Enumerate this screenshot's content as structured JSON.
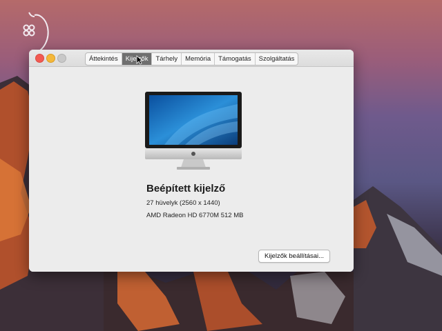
{
  "window": {
    "tabs": [
      {
        "label": "Áttekintés",
        "active": false
      },
      {
        "label": "Kijelzők",
        "active": true
      },
      {
        "label": "Tárhely",
        "active": false
      },
      {
        "label": "Memória",
        "active": false
      },
      {
        "label": "Támogatás",
        "active": false
      },
      {
        "label": "Szolgáltatás",
        "active": false
      }
    ],
    "display": {
      "title": "Beépített kijelző",
      "size_resolution": "27 hüvelyk (2560 x 1440)",
      "graphics": "AMD Radeon HD 6770M 512 MB"
    },
    "settings_button": "Kijelzők beállításai..."
  },
  "colors": {
    "close": "#f25a52",
    "minimize": "#f4b83a",
    "active_tab": "#6f6f6f"
  },
  "icons": [
    "apple-logo-icon",
    "imac-icon",
    "mouse-cursor-icon"
  ]
}
